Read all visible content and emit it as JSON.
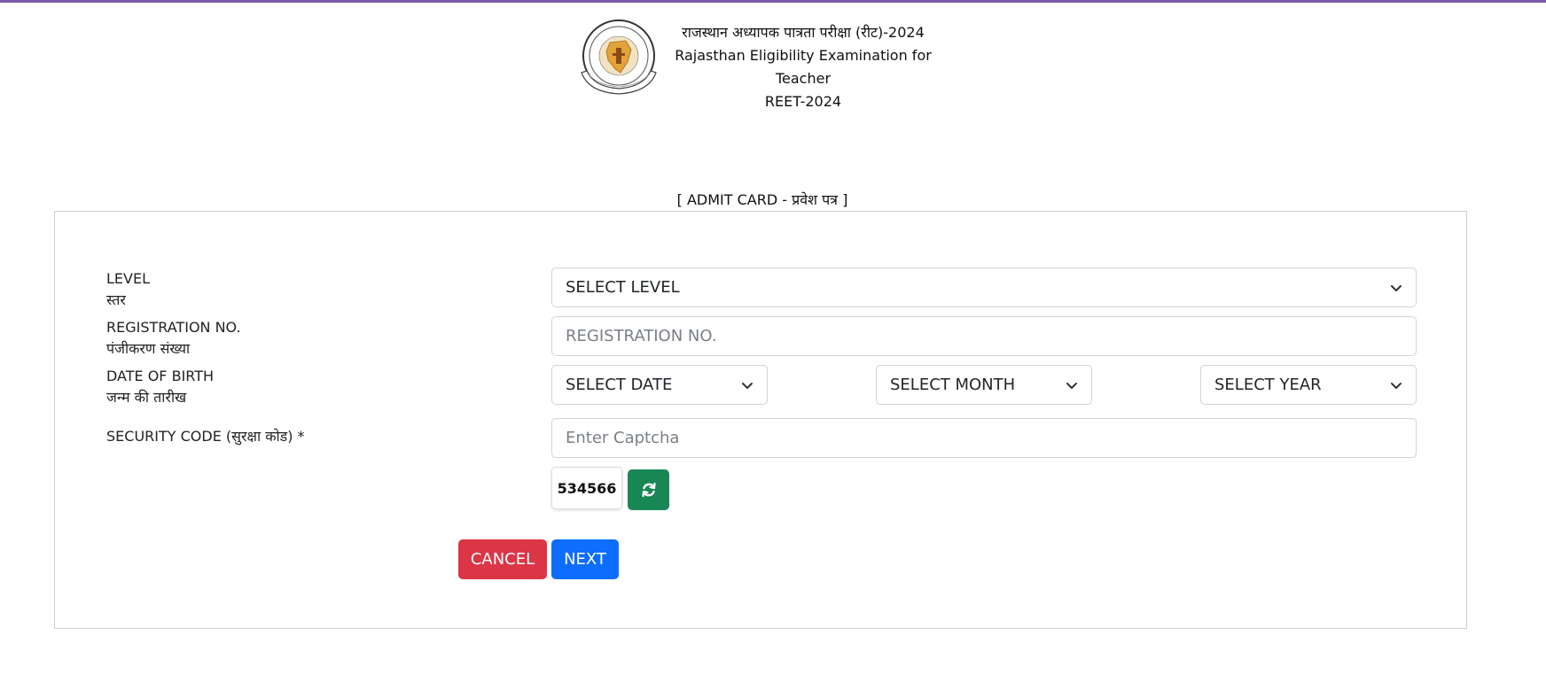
{
  "header": {
    "line1": "राजस्थान अध्यापक पात्रता परीक्षा (रीट)-2024",
    "line2": "Rajasthan Eligibility Examination for Teacher",
    "line3": "REET-2024"
  },
  "page_heading": "[ ADMIT CARD - प्रवेश पत्र ]",
  "form": {
    "level": {
      "label_en": "LEVEL",
      "label_hi": "स्तर",
      "selected": "SELECT LEVEL"
    },
    "registration": {
      "label_en": "REGISTRATION NO.",
      "label_hi": "पंजीकरण संख्या",
      "placeholder": "REGISTRATION NO."
    },
    "dob": {
      "label_en": "DATE OF BIRTH",
      "label_hi": "जन्म की तारीख",
      "date_selected": "SELECT DATE",
      "month_selected": "SELECT MONTH",
      "year_selected": "SELECT YEAR"
    },
    "security": {
      "label": "SECURITY CODE (सुरक्षा कोड) *",
      "placeholder": "Enter Captcha",
      "captcha_value": "534566"
    },
    "buttons": {
      "cancel": "CANCEL",
      "next": "NEXT"
    }
  },
  "colors": {
    "top_border": "#7a5aa8",
    "refresh": "#198754",
    "cancel": "#dc3545",
    "next": "#0d6efd"
  },
  "icons": {
    "logo": "rajasthan-board-seal-icon",
    "refresh": "refresh-icon",
    "dropdown": "chevron-down-icon"
  }
}
